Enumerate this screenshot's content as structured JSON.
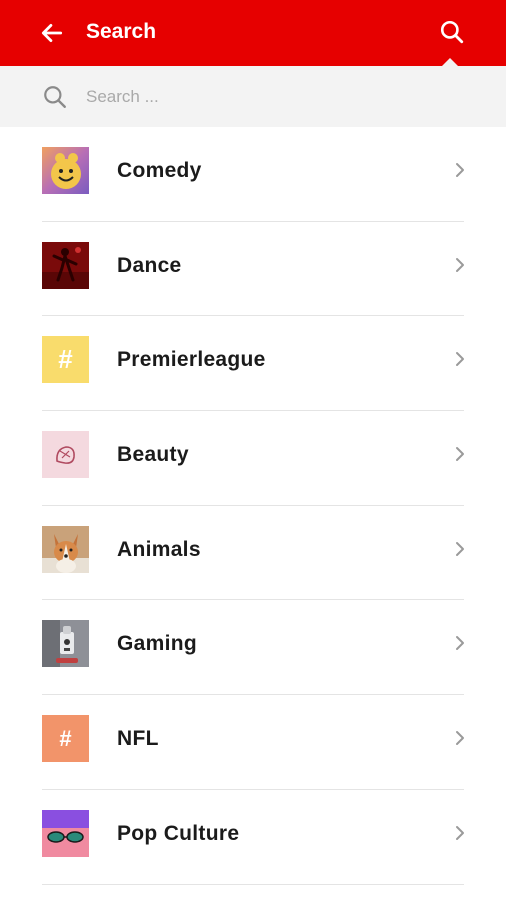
{
  "header": {
    "title": "Search",
    "back_icon": "arrow-left-icon",
    "search_icon": "search-icon",
    "background": "#e60000"
  },
  "search": {
    "placeholder": "Search ...",
    "value": "",
    "icon": "search-icon"
  },
  "categories": [
    {
      "label": "Comedy",
      "thumb": "smiley-face-image"
    },
    {
      "label": "Dance",
      "thumb": "dancer-image"
    },
    {
      "label": "Premierleague",
      "thumb": "hashtag-icon",
      "color": "#f9dc6c"
    },
    {
      "label": "Beauty",
      "thumb": "beauty-image"
    },
    {
      "label": "Animals",
      "thumb": "corgi-image"
    },
    {
      "label": "Gaming",
      "thumb": "gaming-image"
    },
    {
      "label": "NFL",
      "thumb": "hashtag-icon",
      "color": "#f2946a"
    },
    {
      "label": "Pop Culture",
      "thumb": "pop-culture-image"
    }
  ]
}
